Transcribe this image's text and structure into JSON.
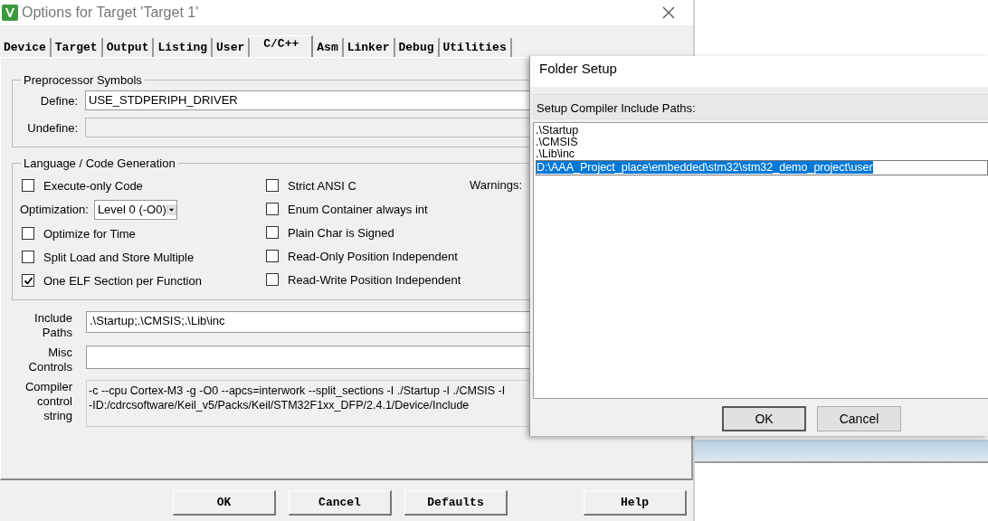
{
  "window": {
    "title": "Options for Target 'Target 1'"
  },
  "tabs": [
    {
      "label": "Device",
      "selected": false
    },
    {
      "label": "Target",
      "selected": false
    },
    {
      "label": "Output",
      "selected": false
    },
    {
      "label": "Listing",
      "selected": false
    },
    {
      "label": "User",
      "selected": false
    },
    {
      "label": "C/C++",
      "selected": true
    },
    {
      "label": "Asm",
      "selected": false
    },
    {
      "label": "Linker",
      "selected": false
    },
    {
      "label": "Debug",
      "selected": false
    },
    {
      "label": "Utilities",
      "selected": false
    }
  ],
  "preprocessor": {
    "title": "Preprocessor Symbols",
    "define_label": "Define:",
    "define_value": "USE_STDPERIPH_DRIVER",
    "undefine_label": "Undefine:"
  },
  "language": {
    "title": "Language / Code Generation",
    "warnings_label": "Warnings:",
    "left": [
      {
        "kind": "checkbox",
        "label": "Execute-only Code",
        "checked": false
      },
      {
        "kind": "dropdown",
        "label": "Optimization:",
        "value": "Level 0 (-O0)"
      },
      {
        "kind": "checkbox",
        "label": "Optimize for Time",
        "checked": false
      },
      {
        "kind": "checkbox",
        "label": "Split Load and Store Multiple",
        "checked": false
      },
      {
        "kind": "checkbox",
        "label": "One ELF Section per Function",
        "checked": true
      }
    ],
    "right": [
      {
        "label": "Strict ANSI C",
        "checked": false
      },
      {
        "label": "Enum Container always int",
        "checked": false
      },
      {
        "label": "Plain Char is Signed",
        "checked": false
      },
      {
        "label": "Read-Only Position Independent",
        "checked": false
      },
      {
        "label": "Read-Write Position Independent",
        "checked": false
      }
    ]
  },
  "include_paths": {
    "label": [
      "Include",
      "Paths"
    ],
    "value": ".\\Startup;.\\CMSIS;.\\Lib\\inc"
  },
  "misc_controls": {
    "label": [
      "Misc",
      "Controls"
    ]
  },
  "compiler_control": {
    "label": [
      "Compiler",
      "control",
      "string"
    ],
    "lines": [
      "-c --cpu Cortex-M3 -g -O0 --apcs=interwork --split_sections -I ./Startup -I ./CMSIS -I",
      "-ID:/cdrcsoftware/Keil_v5/Packs/Keil/STM32F1xx_DFP/2.4.1/Device/Include"
    ]
  },
  "buttons": [
    {
      "label": "OK",
      "kind": "left"
    },
    {
      "label": "Cancel",
      "kind": "left"
    },
    {
      "label": "Defaults",
      "kind": "left"
    },
    {
      "label": "Help",
      "kind": "right"
    }
  ],
  "folder_setup": {
    "title": "Folder Setup",
    "heading": "Setup Compiler Include Paths:",
    "paths": [
      {
        "text": ".\\Startup",
        "selected": false
      },
      {
        "text": ".\\CMSIS",
        "selected": false
      },
      {
        "text": ".\\Lib\\inc",
        "selected": false
      },
      {
        "text": "D:\\AAA_Project_place\\embedded\\stm32\\stm32_demo_project\\user",
        "selected": true
      }
    ],
    "buttons": [
      "OK",
      "Cancel"
    ]
  }
}
